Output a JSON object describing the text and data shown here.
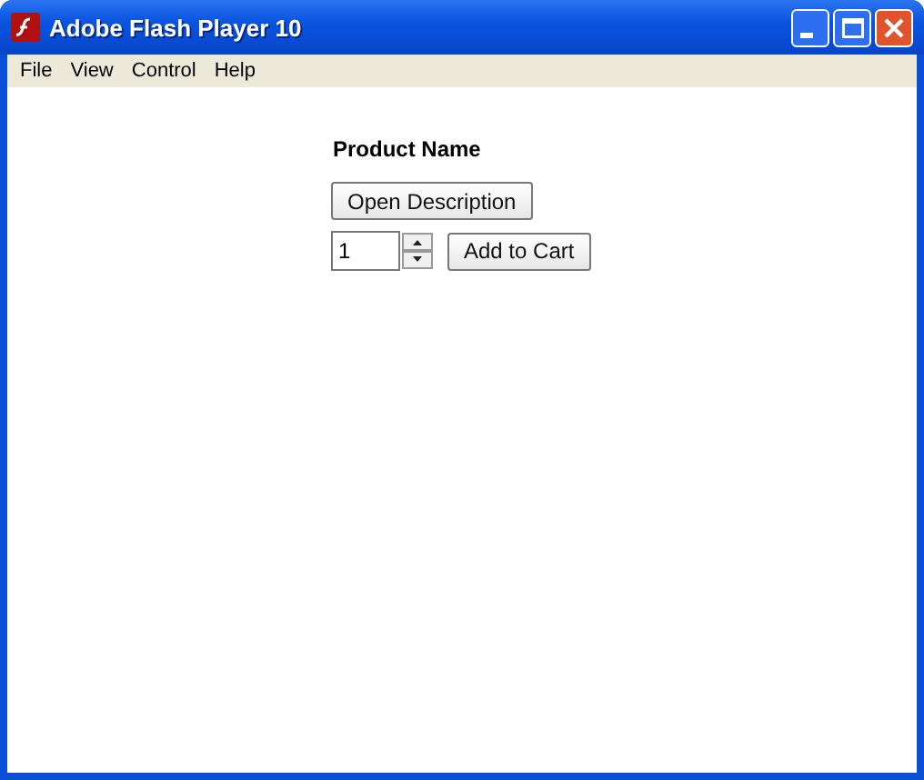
{
  "window": {
    "title": "Adobe Flash Player 10"
  },
  "menu": [
    "File",
    "View",
    "Control",
    "Help"
  ],
  "product": {
    "name": "Product Name",
    "description_button": "Open Description",
    "quantity": "1",
    "add_button": "Add to Cart"
  }
}
